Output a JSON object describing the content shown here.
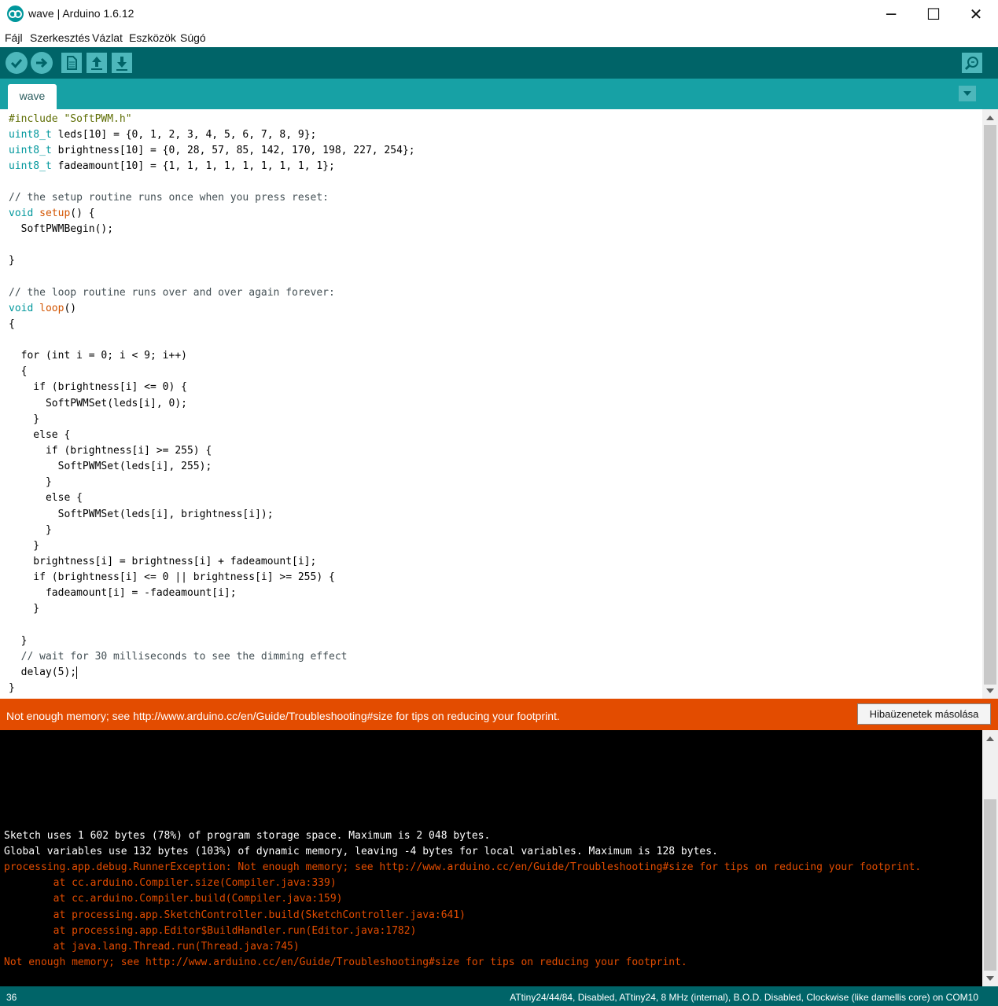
{
  "window": {
    "title": "wave | Arduino 1.6.12",
    "minimize_glyph": "─",
    "maximize_glyph": "☐",
    "close_glyph": "✕"
  },
  "menu": {
    "items": [
      "Fájl",
      "Szerkesztés",
      "Vázlat",
      "Eszközök",
      "Súgó"
    ]
  },
  "toolbar": {
    "icons": [
      "verify-icon",
      "upload-icon",
      "new-icon",
      "open-icon",
      "save-icon",
      "serial-monitor-icon"
    ]
  },
  "tabs": {
    "active": "wave"
  },
  "editor": {
    "lines": [
      {
        "text": "#include \"SoftPWM.h\""
      },
      {
        "kw": "uint8_t",
        "text": " leds[10] = {0, 1, 2, 3, 4, 5, 6, 7, 8, 9};"
      },
      {
        "kw": "uint8_t",
        "text": " brightness[10] = {0, 28, 57, 85, 142, 170, 198, 227, 254};"
      },
      {
        "kw": "uint8_t",
        "text": " fadeamount[10] = {1, 1, 1, 1, 1, 1, 1, 1, 1};"
      },
      {
        "text": ""
      },
      {
        "text": "// the setup routine runs once when you press reset:"
      },
      {
        "kw": "void",
        "fn": "setup",
        "text": "() {"
      },
      {
        "text": "  SoftPWMBegin();"
      },
      {
        "text": ""
      },
      {
        "text": "}"
      },
      {
        "text": ""
      },
      {
        "text": "// the loop routine runs over and over again forever:"
      },
      {
        "kw": "void",
        "fn": "loop",
        "text": "()"
      },
      {
        "text": "{"
      },
      {
        "text": ""
      },
      {
        "text": "  for (int i = 0; i < 9; i++)"
      },
      {
        "text": "  {"
      },
      {
        "text": "    if (brightness[i] <= 0) {"
      },
      {
        "text": "      SoftPWMSet(leds[i], 0);"
      },
      {
        "text": "    }"
      },
      {
        "text": "    else {"
      },
      {
        "text": "      if (brightness[i] >= 255) {"
      },
      {
        "text": "        SoftPWMSet(leds[i], 255);"
      },
      {
        "text": "      }"
      },
      {
        "text": "      else {"
      },
      {
        "text": "        SoftPWMSet(leds[i], brightness[i]);"
      },
      {
        "text": "      }"
      },
      {
        "text": "    }"
      },
      {
        "text": "    brightness[i] = brightness[i] + fadeamount[i];"
      },
      {
        "text": "    if (brightness[i] <= 0 || brightness[i] >= 255) {"
      },
      {
        "text": "      fadeamount[i] = -fadeamount[i];"
      },
      {
        "text": "    }"
      },
      {
        "text": ""
      },
      {
        "text": "  }"
      },
      {
        "text": "  // wait for 30 milliseconds to see the dimming effect"
      },
      {
        "text": "  delay(5);"
      },
      {
        "text": "}"
      }
    ]
  },
  "error_bar": {
    "message": "Not enough memory; see http://www.arduino.cc/en/Guide/Troubleshooting#size for tips on reducing your footprint.",
    "copy_button": "Hibaüzenetek másolása",
    "color": "#e34c00"
  },
  "console": {
    "lines": [
      {
        "text": "Sketch uses 1 602 bytes (78%) of program storage space. Maximum is 2 048 bytes.",
        "color": "#ffffff"
      },
      {
        "text": "Global variables use 132 bytes (103%) of dynamic memory, leaving -4 bytes for local variables. Maximum is 128 bytes.",
        "color": "#ffffff"
      },
      {
        "text": "processing.app.debug.RunnerException: Not enough memory; see http://www.arduino.cc/en/Guide/Troubleshooting#size for tips on reducing your footprint.",
        "color": "#e34c00"
      },
      {
        "text": "\tat cc.arduino.Compiler.size(Compiler.java:339)",
        "color": "#e34c00"
      },
      {
        "text": "\tat cc.arduino.Compiler.build(Compiler.java:159)",
        "color": "#e34c00"
      },
      {
        "text": "\tat processing.app.SketchController.build(SketchController.java:641)",
        "color": "#e34c00"
      },
      {
        "text": "\tat processing.app.Editor$BuildHandler.run(Editor.java:1782)",
        "color": "#e34c00"
      },
      {
        "text": "\tat java.lang.Thread.run(Thread.java:745)",
        "color": "#e34c00"
      },
      {
        "text": "Not enough memory; see http://www.arduino.cc/en/Guide/Troubleshooting#size for tips on reducing your footprint.",
        "color": "#e34c00"
      }
    ]
  },
  "status": {
    "line_number": "36",
    "board_info": "ATtiny24/44/84, Disabled, ATtiny24, 8 MHz (internal), B.O.D. Disabled, Clockwise (like damellis core) on COM10"
  },
  "colors": {
    "toolbar": "#006468",
    "tabbar": "#17a1a5",
    "keyword": "#00979c",
    "function": "#d35400",
    "comment": "#434f54"
  }
}
